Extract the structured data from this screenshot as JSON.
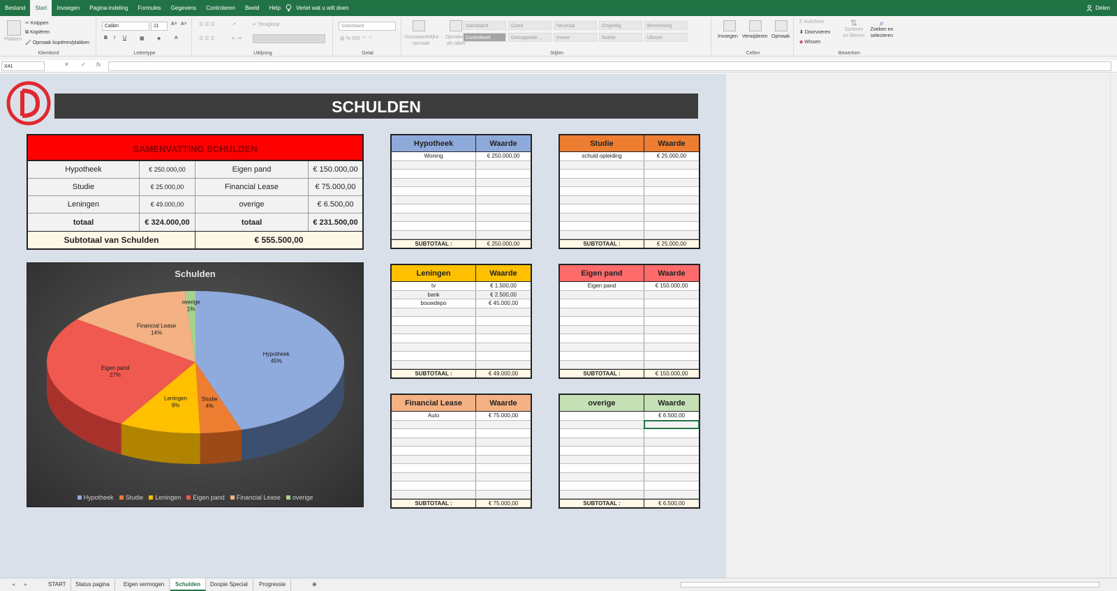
{
  "menu": {
    "tabs": [
      "Bestand",
      "Start",
      "Invoegen",
      "Pagina-indeling",
      "Formules",
      "Gegevens",
      "Controleren",
      "Beeld",
      "Help"
    ],
    "active_tab": "Start",
    "tell_me": "Vertel wat u wilt doen",
    "share": "Delen"
  },
  "ribbon": {
    "clipboard": {
      "paste": "Plakken",
      "cut": "Knippen",
      "copy": "Kopiëren",
      "format_painter": "Opmaak kopiëren/plakken",
      "label": "Klembord"
    },
    "font": {
      "name": "Calibri",
      "size": "11",
      "label": "Lettertype"
    },
    "alignment": {
      "wrap": "Terugloop",
      "label": "Uitlijning"
    },
    "number": {
      "format": "Standaard",
      "label": "Getal"
    },
    "styles": {
      "conditional": "Voorwaardelijke opmaak",
      "as_table": "Opmaken als tabel",
      "cells": [
        "Standaard",
        "Goed",
        "Neutraal",
        "Ongeldig",
        "Berekening",
        "Controlecel",
        "Gekoppelde ...",
        "Invoer",
        "Notitie",
        "Uitvoer"
      ],
      "label": "Stijlen"
    },
    "cells": {
      "insert": "Invoegen",
      "delete": "Verwijderen",
      "format": "Opmaak",
      "label": "Cellen"
    },
    "editing": {
      "autosum": "AutoSom",
      "fill": "Doorvoeren",
      "clear": "Wissen",
      "sort": "Sorteren en filteren",
      "find": "Zoeken en selecteren",
      "label": "Bewerken"
    }
  },
  "formula_bar": {
    "name_box": "X41",
    "fx": "fx",
    "value": ""
  },
  "sheet": {
    "title": "SCHULDEN",
    "summary": {
      "header": "SAMENVATTING SCHULDEN",
      "rows": [
        {
          "l1": "Hypotheek",
          "v1": "€ 250.000,00",
          "l2": "Eigen pand",
          "v2": "€ 150.000,00"
        },
        {
          "l1": "Studie",
          "v1": "€ 25.000,00",
          "l2": "Financial Lease",
          "v2": "€ 75.000,00"
        },
        {
          "l1": "Leningen",
          "v1": "€ 49.000,00",
          "l2": "overige",
          "v2": "€ 6.500,00"
        }
      ],
      "totals": {
        "l1": "totaal",
        "v1": "€ 324.000,00",
        "l2": "totaal",
        "v2": "€ 231.500,00"
      },
      "subtotal_label": "Subtotaal van Schulden",
      "subtotal_value": "€ 555.500,00"
    },
    "tables": [
      {
        "name": "Hypotheek",
        "value_header": "Waarde",
        "color": "#8eaadb",
        "rows": [
          [
            "Woning",
            "€ 250.000,00"
          ]
        ],
        "subtotal_label": "SUBTOTAAL :",
        "subtotal": "€ 250.000,00"
      },
      {
        "name": "Studie",
        "value_header": "Waarde",
        "color": "#ed7d31",
        "rows": [
          [
            "schuld opleiding",
            "€ 25.000,00"
          ]
        ],
        "subtotal_label": "SUBTOTAAL :",
        "subtotal": "€ 25.000,00"
      },
      {
        "name": "Leningen",
        "value_header": "Waarde",
        "color": "#ffc000",
        "rows": [
          [
            "tv",
            "€ 1.500,00"
          ],
          [
            "bank",
            "€ 2.500,00"
          ],
          [
            "bouwdepo",
            "€ 45.000,00"
          ]
        ],
        "subtotal_label": "SUBTOTAAL :",
        "subtotal": "€ 49.000,00"
      },
      {
        "name": "Eigen pand",
        "value_header": "Waarde",
        "color": "#ff6b6b",
        "rows": [
          [
            "Eigen pand",
            "€ 150.000,00"
          ]
        ],
        "subtotal_label": "SUBTOTAAL :",
        "subtotal": "€ 150.000,00"
      },
      {
        "name": "Financial Lease",
        "value_header": "Waarde",
        "color": "#f4b183",
        "rows": [
          [
            "Auto",
            "€ 75.000,00"
          ]
        ],
        "subtotal_label": "SUBTOTAAL :",
        "subtotal": "€ 75.000,00"
      },
      {
        "name": "overige",
        "value_header": "Waarde",
        "color": "#c5e0b4",
        "rows": [
          [
            "",
            "€ 6.500,00"
          ]
        ],
        "subtotal_label": "SUBTOTAAL :",
        "subtotal": "€ 6.500,00"
      }
    ]
  },
  "chart_data": {
    "type": "pie",
    "title": "Schulden",
    "categories": [
      "Hypotheek",
      "Studie",
      "Leningen",
      "Eigen pand",
      "Financial Lease",
      "overige"
    ],
    "values": [
      250000,
      25000,
      49000,
      150000,
      75000,
      6500
    ],
    "labels": [
      "45%",
      "4%",
      "9%",
      "27%",
      "14%",
      "1%"
    ],
    "colors": [
      "#8faadc",
      "#ed7d31",
      "#ffc000",
      "#f0594f",
      "#f4b183",
      "#a9d18e"
    ],
    "side_colors": [
      "#3d4f6e",
      "#9c4a17",
      "#b08400",
      "#a8322b",
      "#b37a55",
      "#6b8a55"
    ],
    "legend": "bottom",
    "style": "3d"
  },
  "sheet_tabs": [
    "START",
    "Status pagina",
    "Eigen vermogen",
    "Schulden",
    "Doopie Special",
    "Progressie"
  ],
  "active_sheet": "Schulden"
}
